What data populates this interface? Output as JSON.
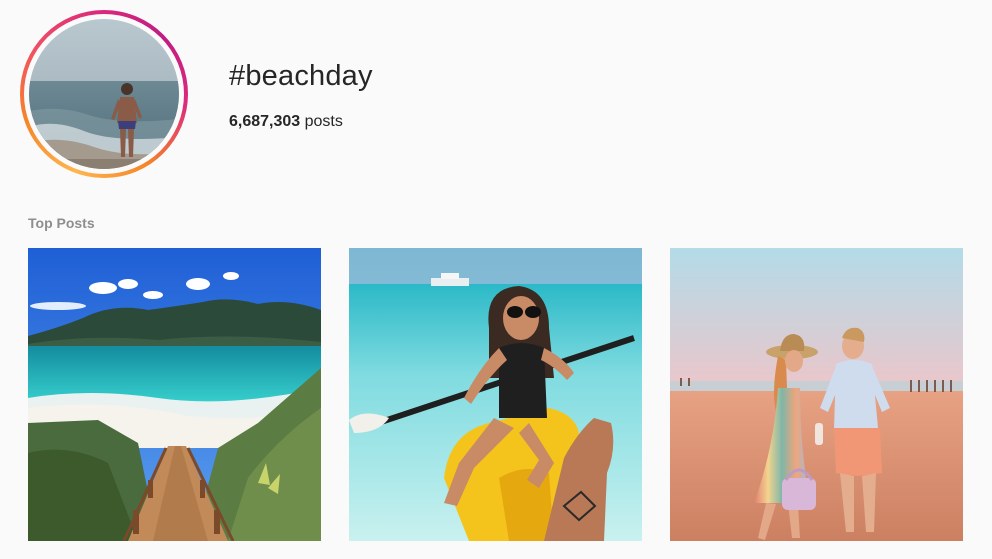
{
  "header": {
    "hashtag": "#beachday",
    "post_count": "6,687,303",
    "post_count_suffix": " posts"
  },
  "sections": {
    "top_posts_label": "Top Posts"
  },
  "colors": {
    "ring_gradient": [
      "#fdb64f",
      "#f58529",
      "#dd2a7b",
      "#c01c84"
    ],
    "background": "#fafafa",
    "label_gray": "#8e8e8e"
  },
  "top_posts": [
    {
      "image": "beach-boardwalk-with-hill"
    },
    {
      "image": "woman-in-yellow-kayak"
    },
    {
      "image": "couple-on-beach-at-sunset"
    }
  ]
}
